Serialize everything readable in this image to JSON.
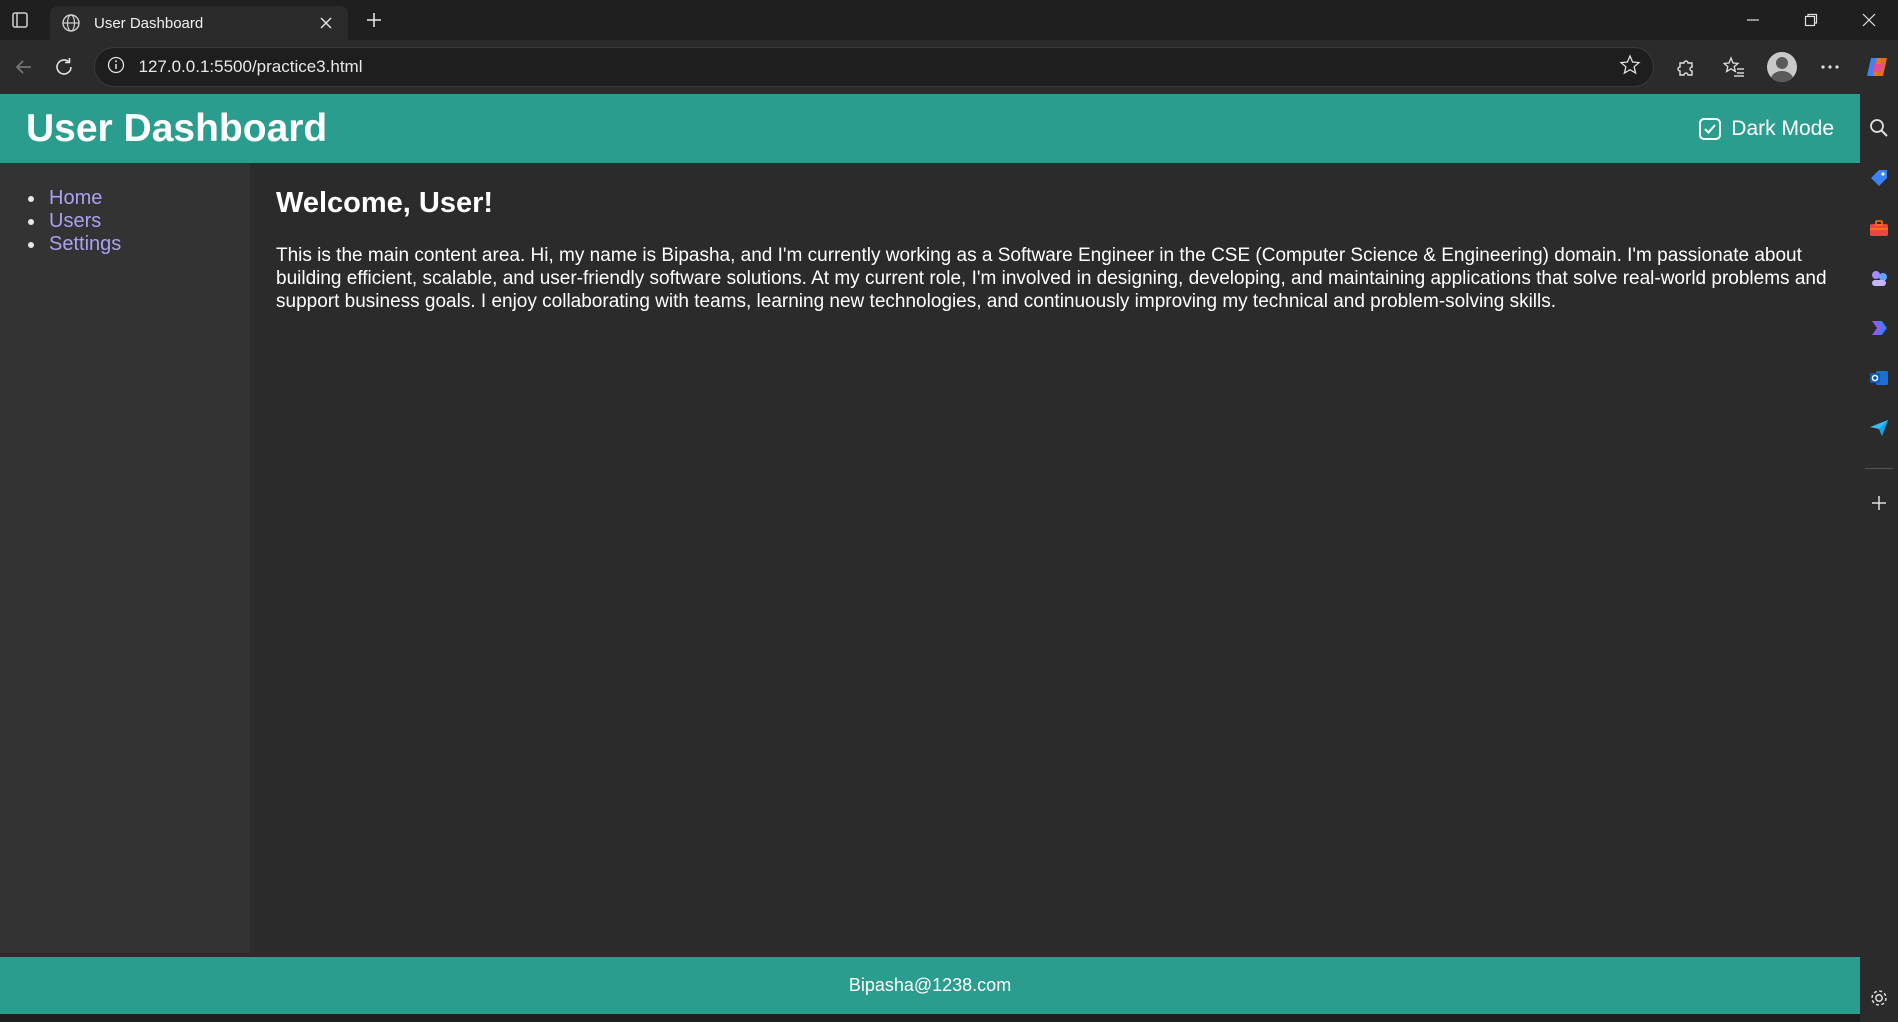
{
  "browser": {
    "tab_title": "User Dashboard",
    "url": "127.0.0.1:5500/practice3.html"
  },
  "header": {
    "title": "User Dashboard",
    "dark_mode_label": "Dark Mode",
    "dark_mode_checked": true
  },
  "sidebar": {
    "items": [
      {
        "label": "Home"
      },
      {
        "label": "Users"
      },
      {
        "label": "Settings"
      }
    ]
  },
  "main": {
    "heading": "Welcome, User!",
    "body": "This is the main content area. Hi, my name is Bipasha, and I'm currently working as a Software Engineer in the CSE (Computer Science & Engineering) domain. I'm passionate about building efficient, scalable, and user-friendly software solutions. At my current role, I'm involved in designing, developing, and maintaining applications that solve real-world problems and support business goals. I enjoy collaborating with teams, learning new technologies, and continuously improving my technical and problem-solving skills."
  },
  "footer": {
    "email": "Bipasha@1238.com"
  },
  "colors": {
    "accent": "#2a9d8f",
    "link": "#a9a2f0",
    "background": "#2b2b2b",
    "sidebar_bg": "#333333"
  },
  "icons": {
    "tab_actions": "tab-actions-icon",
    "site": "globe-icon",
    "close_tab": "close-icon",
    "new_tab": "plus-icon",
    "back": "back-arrow-icon",
    "reload": "reload-icon",
    "site_info": "info-icon",
    "favorite": "star-icon",
    "extensions": "puzzle-icon",
    "favorites": "favorites-list-icon",
    "profile": "avatar-icon",
    "more": "more-icon"
  }
}
